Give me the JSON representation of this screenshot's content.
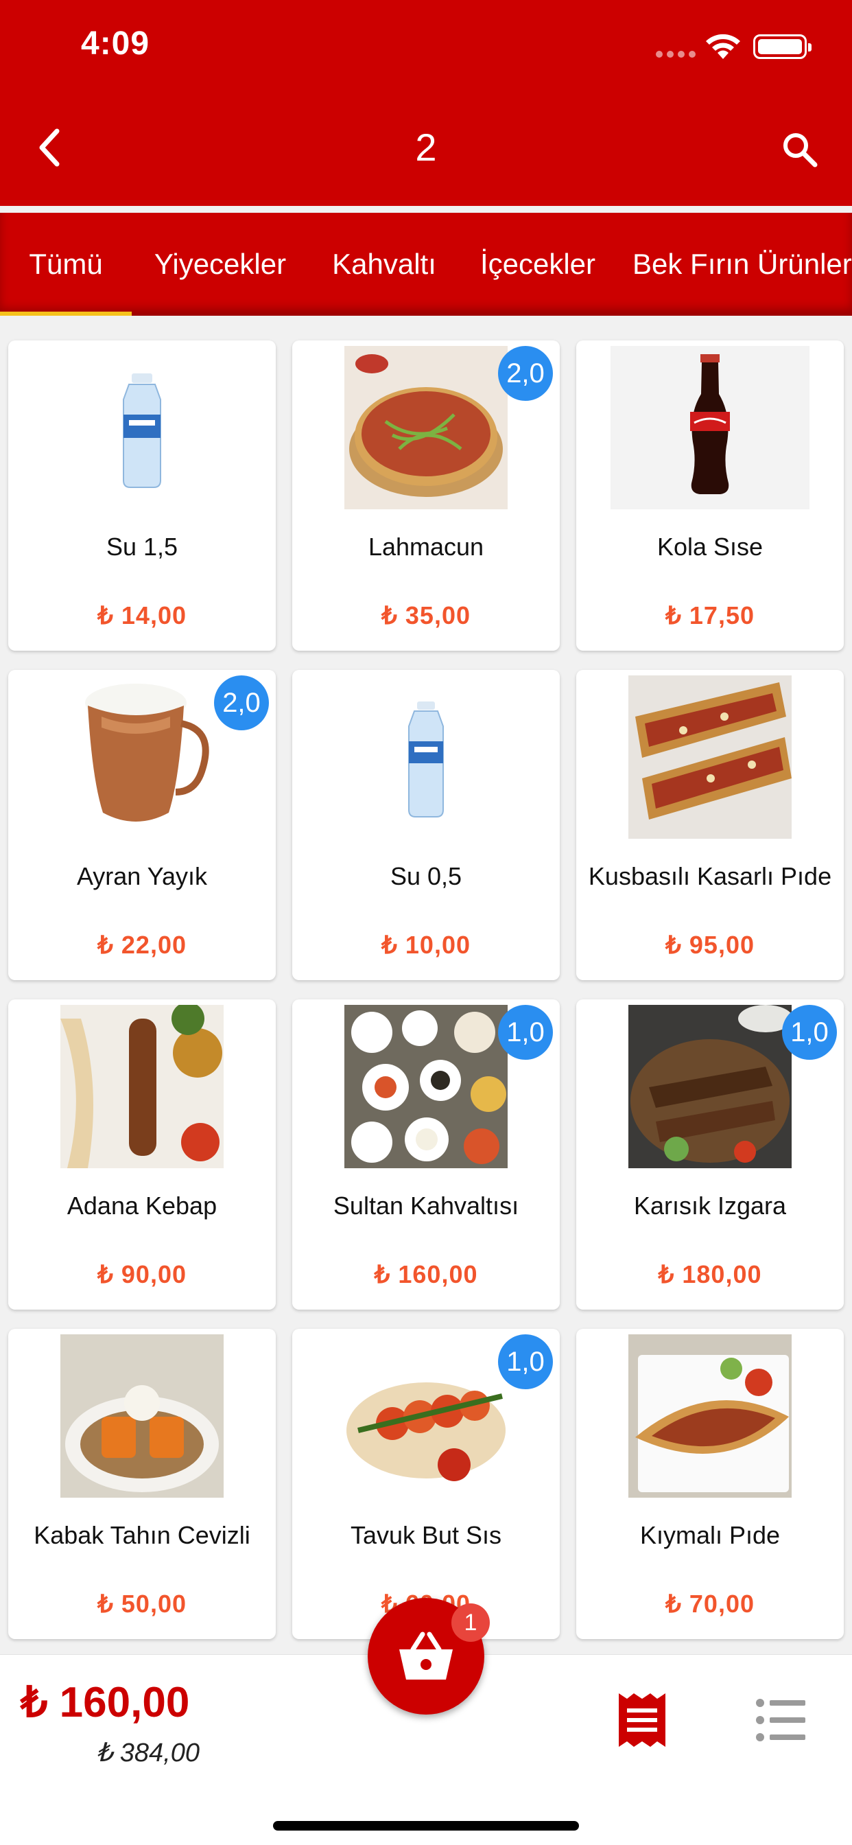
{
  "status_bar": {
    "time": "4:09"
  },
  "header": {
    "title": "2"
  },
  "colors": {
    "brand": "#cc0000",
    "price": "#f2552c",
    "badge": "#2a8ef0",
    "tab_indicator": "#f6c21c"
  },
  "tabs": [
    {
      "label": "Tümü",
      "active": true
    },
    {
      "label": "Yiyecekler"
    },
    {
      "label": "Kahvaltı"
    },
    {
      "label": "İçecekler"
    },
    {
      "label": "Bek Fırın Ürünleri"
    }
  ],
  "products": [
    {
      "name": "Su 1,5",
      "price": "₺ 14,00",
      "image": "water-bottle-large-icon"
    },
    {
      "name": "Lahmacun",
      "price": "₺ 35,00",
      "badge": "2,0",
      "image": "lahmacun-image"
    },
    {
      "name": "Kola Sıse",
      "price": "₺ 17,50",
      "image": "cola-bottle-image"
    },
    {
      "name": "Ayran Yayık",
      "price": "₺ 22,00",
      "badge": "2,0",
      "image": "ayran-cup-image"
    },
    {
      "name": "Su 0,5",
      "price": "₺ 10,00",
      "image": "water-bottle-small-icon"
    },
    {
      "name": "Kusbasılı Kasarlı Pıde",
      "price": "₺ 95,00",
      "image": "pide-image"
    },
    {
      "name": "Adana Kebap",
      "price": "₺ 90,00",
      "image": "adana-kebap-image"
    },
    {
      "name": "Sultan Kahvaltısı",
      "price": "₺ 160,00",
      "badge": "1,0",
      "image": "breakfast-image"
    },
    {
      "name": "Karısık Izgara",
      "price": "₺ 180,00",
      "badge": "1,0",
      "image": "mixed-grill-image"
    },
    {
      "name": "Kabak Tahın Cevizli",
      "price": "₺ 50,00",
      "image": "pumpkin-dessert-image"
    },
    {
      "name": "Tavuk But Sıs",
      "price": "₺ 60,00",
      "badge": "1,0",
      "image": "chicken-skewer-image"
    },
    {
      "name": "Kıymalı Pıde",
      "price": "₺ 70,00",
      "image": "minced-pide-image"
    }
  ],
  "cart": {
    "count": "1",
    "total": "₺ 160,00",
    "subtotal": "₺ 384,00"
  }
}
